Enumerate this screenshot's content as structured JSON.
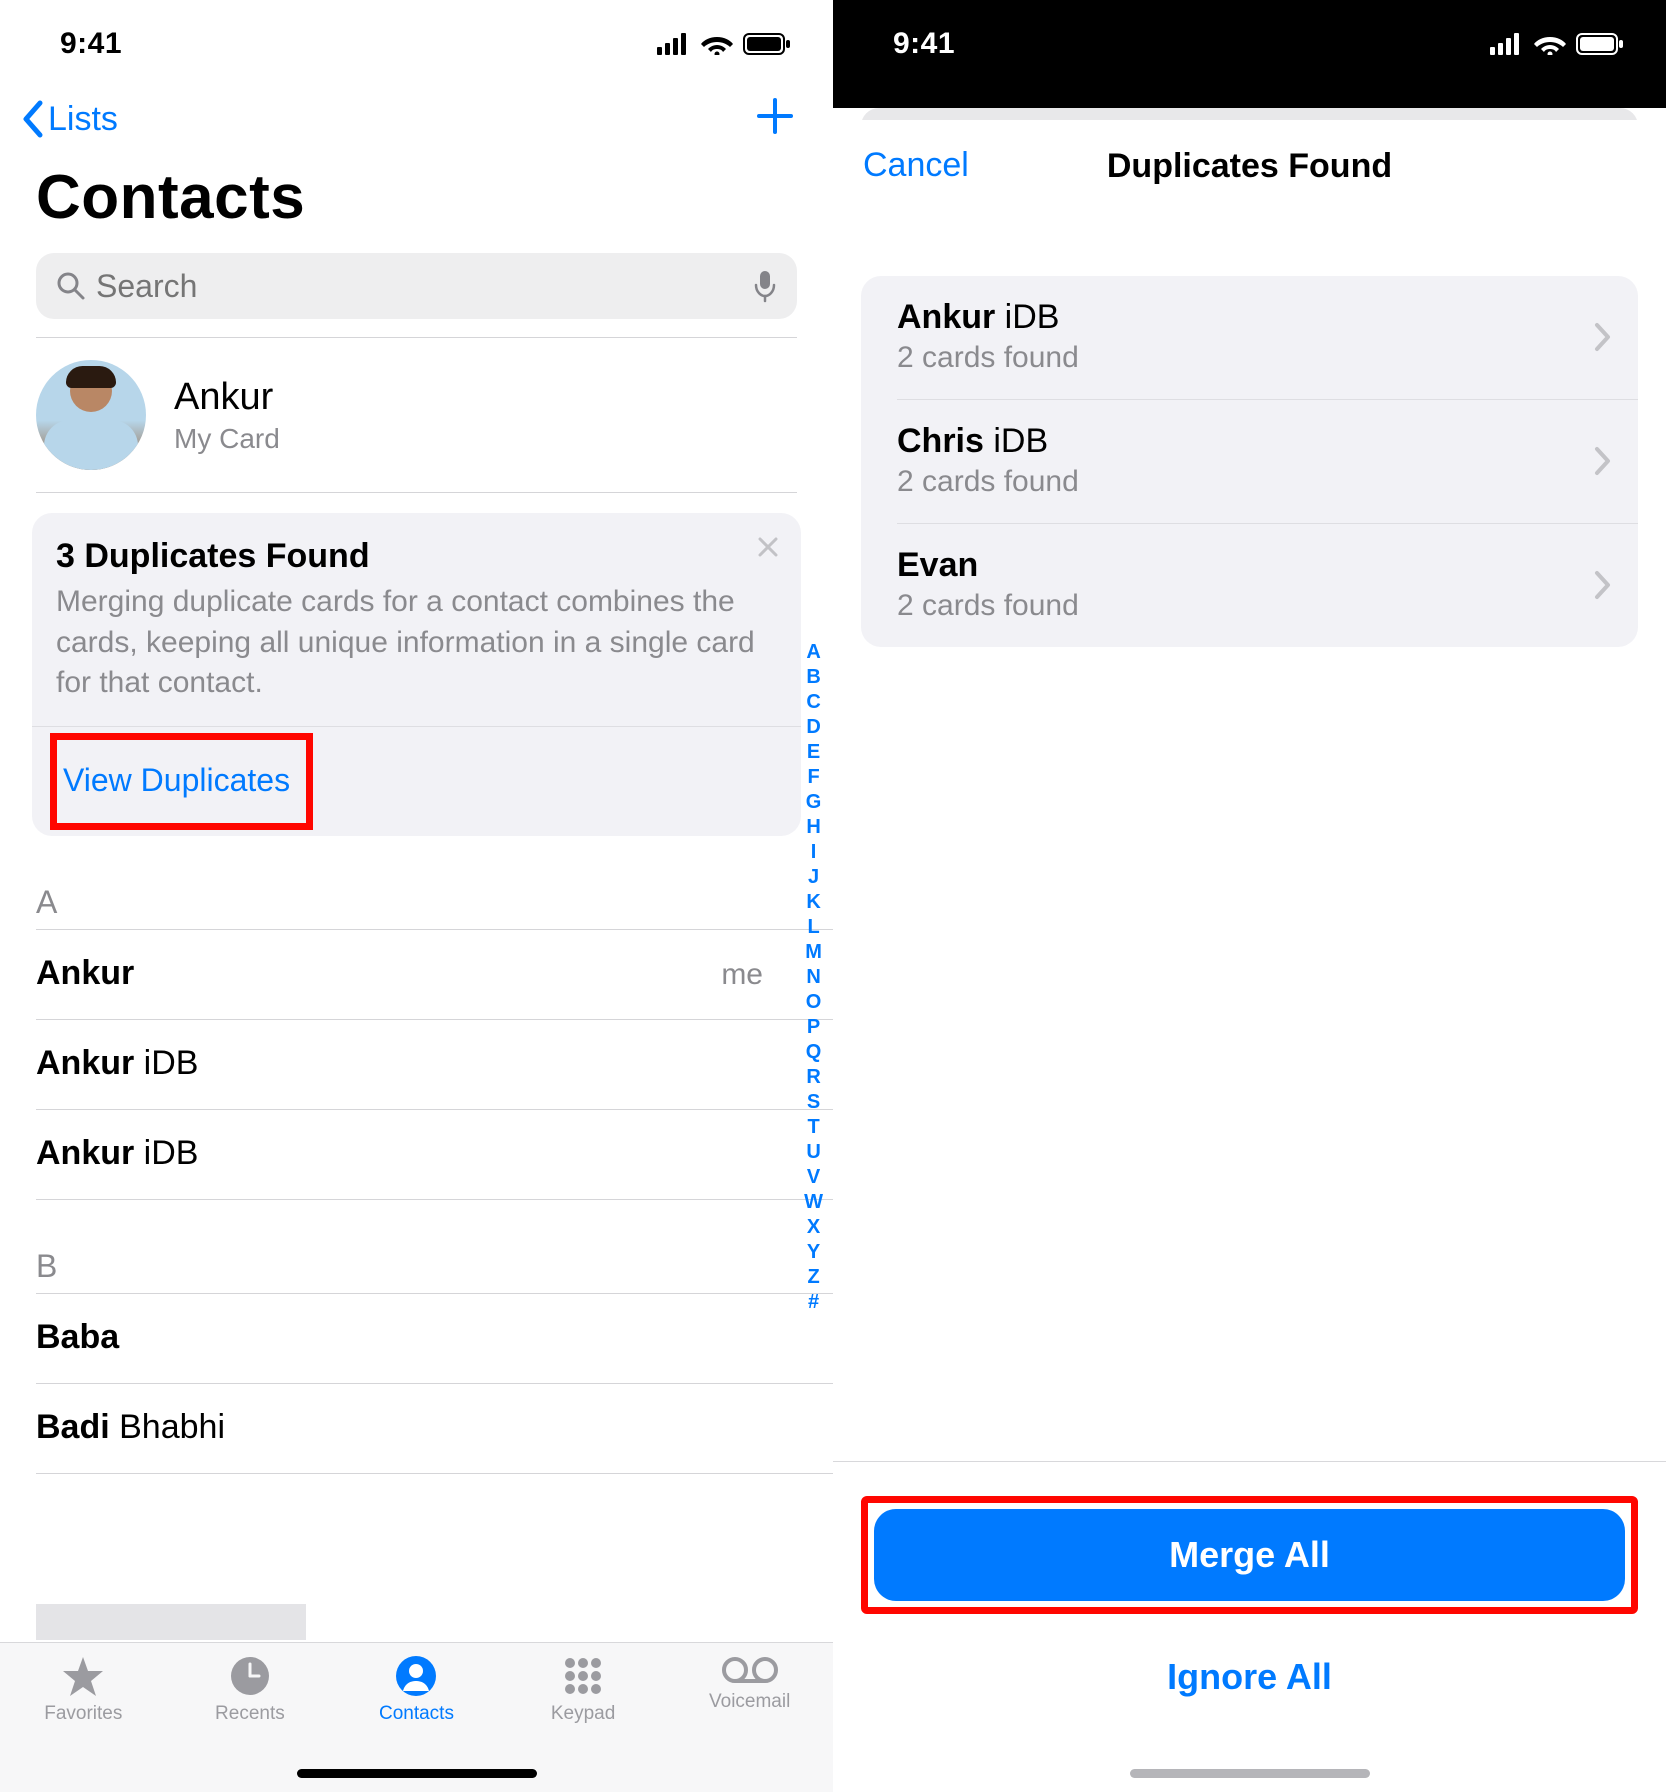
{
  "statusbar": {
    "time": "9:41"
  },
  "left": {
    "back_label": "Lists",
    "title": "Contacts",
    "search_placeholder": "Search",
    "mycard": {
      "name": "Ankur",
      "sub": "My Card"
    },
    "dup_banner": {
      "title": "3 Duplicates Found",
      "desc": "Merging duplicate cards for a contact combines the cards, keeping all unique information in a single card for that contact.",
      "link": "View Duplicates"
    },
    "sections": [
      {
        "letter": "A",
        "rows": [
          {
            "first": "Ankur",
            "rest": "",
            "tag": "me"
          },
          {
            "first": "Ankur",
            "rest": " iDB",
            "tag": ""
          },
          {
            "first": "Ankur",
            "rest": " iDB",
            "tag": ""
          }
        ]
      },
      {
        "letter": "B",
        "rows": [
          {
            "first": "Baba",
            "rest": "",
            "tag": ""
          },
          {
            "first": "Badi",
            "rest": " Bhabhi",
            "tag": ""
          }
        ]
      }
    ],
    "index": [
      "A",
      "B",
      "C",
      "D",
      "E",
      "F",
      "G",
      "H",
      "I",
      "J",
      "K",
      "L",
      "M",
      "N",
      "O",
      "P",
      "Q",
      "R",
      "S",
      "T",
      "U",
      "V",
      "W",
      "X",
      "Y",
      "Z",
      "#"
    ],
    "tabs": {
      "favorites": "Favorites",
      "recents": "Recents",
      "contacts": "Contacts",
      "keypad": "Keypad",
      "voicemail": "Voicemail"
    }
  },
  "right": {
    "cancel": "Cancel",
    "title": "Duplicates Found",
    "items": [
      {
        "first": "Ankur",
        "rest": " iDB",
        "sub": "2 cards found"
      },
      {
        "first": "Chris",
        "rest": " iDB",
        "sub": "2 cards found"
      },
      {
        "first": "Evan",
        "rest": "",
        "sub": "2 cards found"
      }
    ],
    "merge": "Merge All",
    "ignore": "Ignore All"
  }
}
